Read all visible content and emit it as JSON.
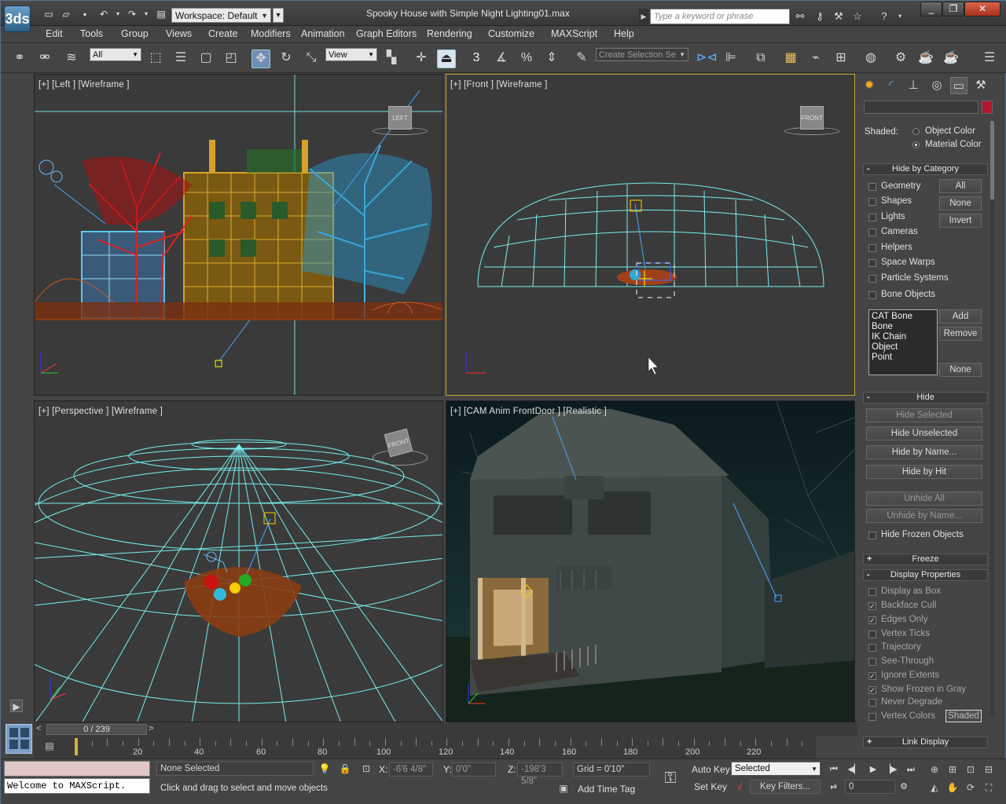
{
  "app": {
    "logo": "3ds",
    "document_title": "Spooky House with Simple Night Lighting01.max",
    "workspace": "Workspace: Default",
    "search_placeholder": "Type a keyword or phrase"
  },
  "titlebar": {
    "quick_icons": [
      "new-file-icon",
      "open-file-icon",
      "save-icon",
      "undo-icon",
      "redo-icon",
      "project-folder-icon"
    ],
    "right_icons": [
      "binoculars-icon",
      "wrench-icon",
      "tools-icon",
      "star-icon",
      "help-icon"
    ],
    "window": {
      "minimize": "_",
      "restore": "❐",
      "close": "✕"
    }
  },
  "menu": [
    "Edit",
    "Tools",
    "Group",
    "Views",
    "Create",
    "Modifiers",
    "Animation",
    "Graph Editors",
    "Rendering",
    "Customize",
    "MAXScript",
    "Help"
  ],
  "toolbar": {
    "selection_filter": "All",
    "ref_coord": "View",
    "named_selection": "Create Selection Se",
    "snap_labels": {
      "snap": "3",
      "angle": "",
      "percent": "%",
      "spinner": ""
    }
  },
  "viewports": [
    {
      "label": "[+] [Left ] [Wireframe ]",
      "cube": "LEFT"
    },
    {
      "label": "[+] [Front ] [Wireframe ]",
      "cube": "FRONT"
    },
    {
      "label": "[+] [Perspective ] [Wireframe ]",
      "cube": "FRONT"
    },
    {
      "label": "[+] [CAM Anim FrontDoor ] [Realistic ]",
      "cube": ""
    }
  ],
  "cmdpanel": {
    "shaded_label": "Shaded:",
    "object_color": "Object Color",
    "material_color": "Material Color",
    "shaded_choice": "Material Color",
    "hide_by_category": {
      "title": "Hide by Category",
      "items": [
        {
          "label": "Geometry",
          "checked": false
        },
        {
          "label": "Shapes",
          "checked": false
        },
        {
          "label": "Lights",
          "checked": false
        },
        {
          "label": "Cameras",
          "checked": false
        },
        {
          "label": "Helpers",
          "checked": false
        },
        {
          "label": "Space Warps",
          "checked": false
        },
        {
          "label": "Particle Systems",
          "checked": false
        },
        {
          "label": "Bone Objects",
          "checked": false
        }
      ],
      "buttons": [
        "All",
        "None",
        "Invert"
      ],
      "list": [
        "CAT Bone",
        "Bone",
        "IK Chain Object",
        "Point"
      ],
      "list_buttons": [
        "Add",
        "Remove",
        "None"
      ]
    },
    "hide": {
      "title": "Hide",
      "buttons": [
        "Hide Selected",
        "Hide Unselected",
        "Hide by Name...",
        "Hide by Hit",
        "Unhide All",
        "Unhide by Name..."
      ],
      "frozen_label": "Hide Frozen Objects"
    },
    "freeze": {
      "title": "Freeze"
    },
    "display_properties": {
      "title": "Display Properties",
      "items": [
        {
          "label": "Display as Box",
          "checked": false
        },
        {
          "label": "Backface Cull",
          "checked": true
        },
        {
          "label": "Edges Only",
          "checked": true
        },
        {
          "label": "Vertex Ticks",
          "checked": false
        },
        {
          "label": "Trajectory",
          "checked": false
        },
        {
          "label": "See-Through",
          "checked": false
        },
        {
          "label": "Ignore Extents",
          "checked": true
        },
        {
          "label": "Show Frozen in Gray",
          "checked": true
        },
        {
          "label": "Never Degrade",
          "checked": false
        },
        {
          "label": "Vertex Colors",
          "checked": false
        }
      ],
      "shaded_button": "Shaded"
    },
    "link_display": {
      "title": "Link Display"
    }
  },
  "timeslider": {
    "label": "0 / 239",
    "prev": "<",
    "next": ">"
  },
  "trackbar": {
    "labels": [
      "20",
      "40",
      "60",
      "80",
      "100",
      "120",
      "140",
      "160",
      "180",
      "200",
      "220"
    ]
  },
  "status": {
    "maxscript_output": "",
    "maxscript_listener": "Welcome to MAXScript.",
    "selection": "None Selected",
    "prompt": "Click and drag to select and move objects",
    "x_label": "X:",
    "x": "-6'6 4/8\"",
    "y_label": "Y:",
    "y": "0'0\"",
    "z_label": "Z:",
    "z": "-198'3 5/8\"",
    "grid": "Grid = 0'10\"",
    "add_time_tag": "Add Time Tag",
    "auto_key": "Auto Key",
    "set_key": "Set Key",
    "key_mode": "Selected",
    "key_filters": "Key Filters...",
    "frame": "0"
  }
}
